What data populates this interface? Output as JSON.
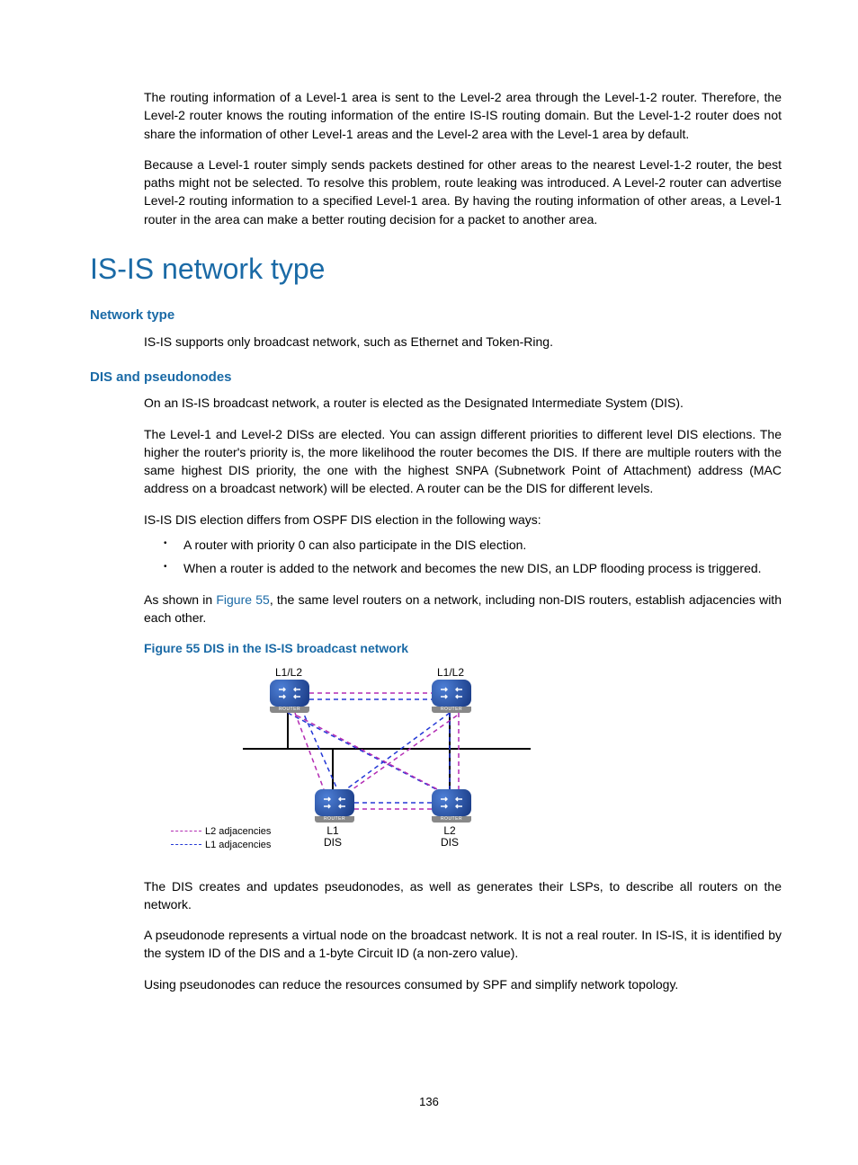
{
  "p1": "The routing information of a Level-1 area is sent to the Level-2 area through the Level-1-2 router. Therefore, the Level-2 router knows the routing information of the entire IS-IS routing domain. But the Level-1-2 router does not share the information of other Level-1 areas and the Level-2 area with the Level-1 area by default.",
  "p2": "Because a Level-1 router simply sends packets destined for other areas to the nearest Level-1-2 router, the best paths might not be selected. To resolve this problem, route leaking was introduced. A Level-2 router can advertise Level-2 routing information to a specified Level-1 area. By having the routing information of other areas, a Level-1 router in the area can make a better routing decision for a packet to another area.",
  "h1": "IS-IS network type",
  "h2a": "Network type",
  "p3": "IS-IS supports only broadcast network, such as Ethernet and Token-Ring.",
  "h2b": "DIS and pseudonodes",
  "p4": "On an IS-IS broadcast network, a router is elected as the Designated Intermediate System (DIS).",
  "p5": "The Level-1 and Level-2 DISs are elected. You can assign different priorities to different level DIS elections. The higher the router's priority is, the more likelihood the router becomes the DIS. If there are multiple routers with the same highest DIS priority, the one with the highest SNPA (Subnetwork Point of Attachment) address (MAC address on a broadcast network) will be elected. A router can be the DIS for different levels.",
  "p6": "IS-IS DIS election differs from OSPF DIS election in the following ways:",
  "b1": "A router with priority 0 can also participate in the DIS election.",
  "b2": "When a router is added to the network and becomes the new DIS, an LDP flooding process is triggered.",
  "p7a": "As shown in ",
  "xref": "Figure 55",
  "p7b": ", the same level routers on a network, including non-DIS routers, establish adjacencies with each other.",
  "figcap": "Figure 55 DIS in the IS-IS broadcast network",
  "lbl_tl": "L1/L2",
  "lbl_tr": "L1/L2",
  "lbl_bl1": "L1",
  "lbl_bl2": "DIS",
  "lbl_br1": "L2",
  "lbl_br2": "DIS",
  "leg_l2": "L2 adjacencies",
  "leg_l1": "L1 adjacencies",
  "router_tag": "ROUTER",
  "p8": "The DIS creates and updates pseudonodes, as well as generates their LSPs, to describe all routers on the network.",
  "p9": "A pseudonode represents a virtual node on the broadcast network. It is not a real router. In IS-IS, it is identified by the system ID of the DIS and a 1-byte Circuit ID (a non-zero value).",
  "p10": "Using pseudonodes can reduce the resources consumed by SPF and simplify network topology.",
  "pagenum": "136"
}
